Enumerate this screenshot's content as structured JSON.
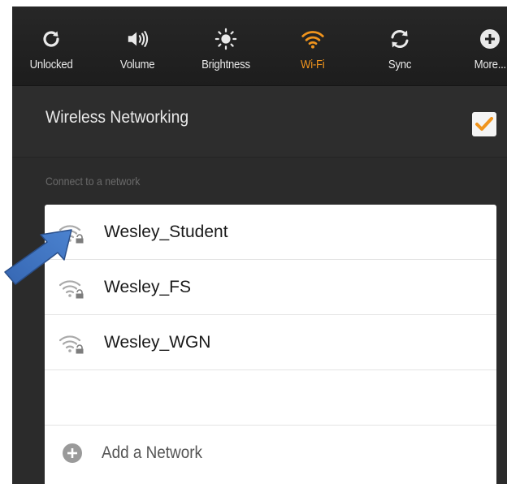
{
  "quick_settings": {
    "items": [
      {
        "label": "Unlocked",
        "icon": "rotate-unlocked-icon",
        "active": false
      },
      {
        "label": "Volume",
        "icon": "volume-icon",
        "active": false
      },
      {
        "label": "Brightness",
        "icon": "brightness-icon",
        "active": false
      },
      {
        "label": "Wi-Fi",
        "icon": "wifi-icon",
        "active": true
      },
      {
        "label": "Sync",
        "icon": "sync-icon",
        "active": false
      },
      {
        "label": "More...",
        "icon": "plus-circle-icon",
        "active": false
      }
    ],
    "active_color": "#f0941d"
  },
  "wireless": {
    "title": "Wireless Networking",
    "enabled": true,
    "check_color": "#f0941d"
  },
  "networks": {
    "section_label": "Connect to a network",
    "items": [
      {
        "name": "Wesley_Student",
        "secured": true
      },
      {
        "name": "Wesley_FS",
        "secured": true
      },
      {
        "name": "Wesley_WGN",
        "secured": true
      }
    ],
    "add_label": "Add a Network"
  },
  "annotation": {
    "arrow_color": "#3f75c2",
    "points_to": "Wesley_Student"
  }
}
